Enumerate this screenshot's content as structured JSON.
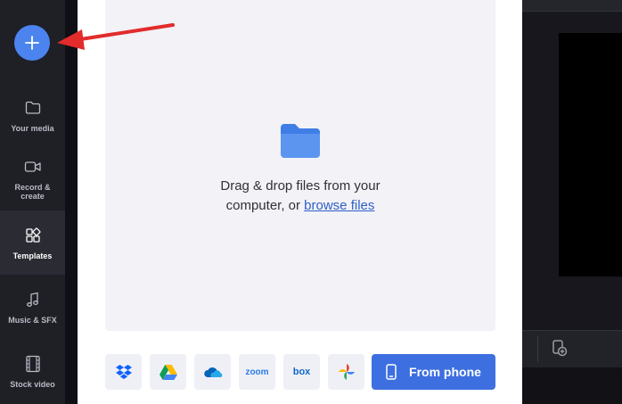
{
  "sidebar": {
    "items": [
      {
        "label": "Your media",
        "icon": "folder-icon"
      },
      {
        "label": "Record & create",
        "icon": "video-camera-icon"
      },
      {
        "label": "Templates",
        "icon": "templates-icon"
      },
      {
        "label": "Music & SFX",
        "icon": "music-note-icon"
      },
      {
        "label": "Stock video",
        "icon": "film-strip-icon"
      }
    ],
    "active_index": 2
  },
  "dropzone": {
    "text_line1": "Drag & drop files from your",
    "text_line2": "computer, or ",
    "link": "browse files"
  },
  "sources": {
    "zoom_label": "zoom",
    "box_label": "box",
    "phone_label": "From phone"
  },
  "colors": {
    "accent": "#4b84ee",
    "primary_button": "#3d6fe0",
    "annotation_arrow": "#e32b2b",
    "link": "#2e5fc7"
  }
}
